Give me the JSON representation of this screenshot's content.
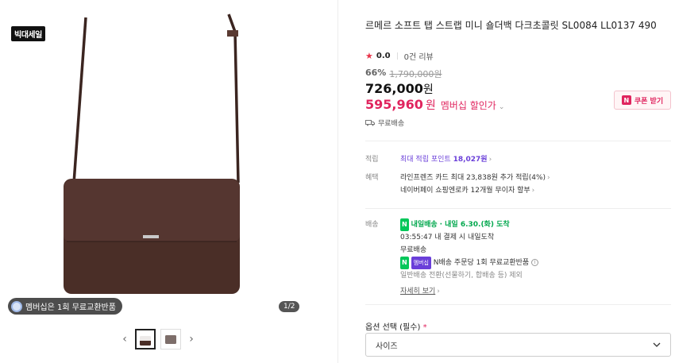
{
  "gallery": {
    "sale_badge": "빅대세일",
    "membership_chip": "멤버십은 1회 무료교환반품",
    "page_indicator": "1/2",
    "prev_icon": "chevron-left-icon",
    "next_icon": "chevron-right-icon",
    "thumb_count": 2,
    "active_thumb": 1
  },
  "product": {
    "title": "르메르 소프트 탭 스트랩 미니 숄더백 다크초콜릿 SL0084 LL0137 490",
    "rating_score": "0.0",
    "review_count": "0건 리뷰",
    "discount_pct": "66%",
    "original_price": "1,790,000원",
    "price": "726,000",
    "price_unit": "원",
    "member_price": "595,960",
    "member_price_unit": "원",
    "member_price_label": "멤버십 할인가",
    "coupon_label": "쿠폰 받기",
    "shipping_label": "무료배송"
  },
  "details": {
    "points": {
      "label": "적립",
      "text_prefix": "최대 적립 포인트",
      "amount": "18,027원"
    },
    "benefits": {
      "label": "혜택",
      "line1": "라인프렌즈 카드 최대 23,838원 추가 적립(4%)",
      "line2": "네이버페이 쇼핑엔로카 12개월 무이자 할부"
    },
    "delivery": {
      "label": "배송",
      "badge": "내일배송",
      "arrival": "· 내일 6.30.(화) 도착",
      "cutoff": "03:55:47  내 결제 시 내일도착",
      "fee": "무료배송",
      "membership_tag": "멤버십",
      "npay_text": "N배송 주문당 1회 무료교환반품",
      "note": "일반배송 전환(선물하기, 합배송 등) 제외",
      "more_link": "자세히 보기"
    }
  },
  "option": {
    "label": "옵션 선택 (필수)",
    "required_mark": "*",
    "select_value": "사이즈"
  },
  "colors": {
    "accent_red": "#e0245e",
    "accent_purple": "#6a3fd9",
    "accent_green": "#03c75a",
    "bag_brown": "#4a2e27"
  }
}
